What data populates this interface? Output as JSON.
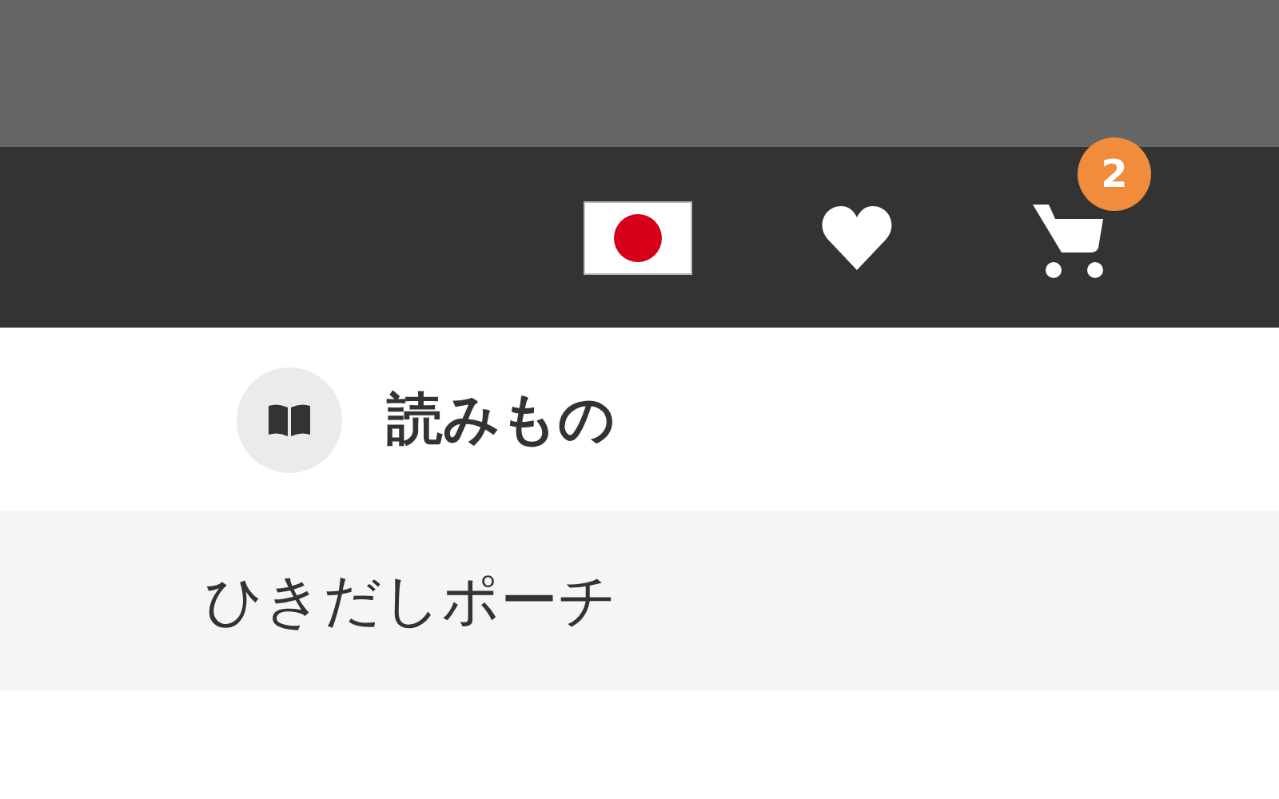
{
  "header": {
    "cart_badge": "2"
  },
  "section": {
    "title": "読みもの"
  },
  "items": [
    {
      "label": "ひきだしポーチ"
    }
  ]
}
